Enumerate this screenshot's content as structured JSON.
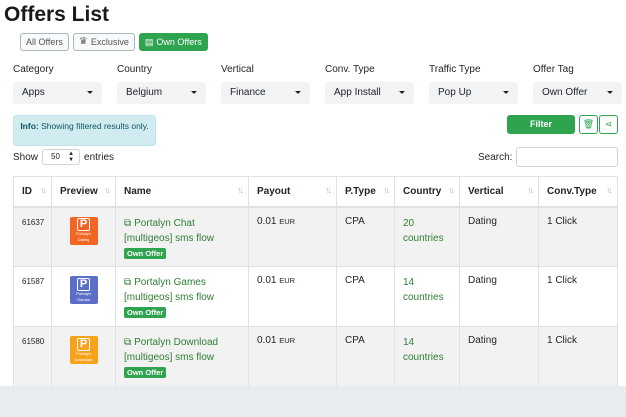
{
  "page": {
    "title": "Offers List"
  },
  "tabs": [
    {
      "label": "All Offers",
      "icon": ""
    },
    {
      "label": "Exclusive",
      "icon": "crown-icon"
    },
    {
      "label": "Own Offers",
      "icon": "document-icon"
    }
  ],
  "filters": [
    {
      "label": "Category",
      "value": "Apps"
    },
    {
      "label": "Country",
      "value": "Belgium"
    },
    {
      "label": "Vertical",
      "value": "Finance"
    },
    {
      "label": "Conv. Type",
      "value": "App Install"
    },
    {
      "label": "Traffic Type",
      "value": "Pop Up"
    },
    {
      "label": "Offer Tag",
      "value": "Own Offer"
    }
  ],
  "info": {
    "prefix": "Info:",
    "text": "Showing filtered results only."
  },
  "actions": {
    "filter_label": "Filter",
    "trash_icon": "trash-icon",
    "share_icon": "share-icon"
  },
  "length": {
    "show": "Show",
    "value": "50",
    "entries": "entries"
  },
  "search": {
    "label": "Search:"
  },
  "table": {
    "columns": [
      "ID",
      "Preview",
      "Name",
      "Payout",
      "P.Type",
      "Country",
      "Vertical",
      "Conv.Type"
    ],
    "rows": [
      {
        "id": "61637",
        "preview_text": "Portalyn",
        "preview_sub": "Dating",
        "preview_color": "#f26522",
        "name": "Portalyn Chat [multigeos] sms flow",
        "badge": "Own Offer",
        "payout": "0.01",
        "currency": "EUR",
        "ptype": "CPA",
        "country": "20 countries",
        "vertical": "Dating",
        "conv": "1 Click"
      },
      {
        "id": "61587",
        "preview_text": "Portalyn",
        "preview_sub": "Games",
        "preview_color": "#5b6fc7",
        "name": "Portalyn Games [multigeos] sms flow",
        "badge": "Own Offer",
        "payout": "0.01",
        "currency": "EUR",
        "ptype": "CPA",
        "country": "14 countries",
        "vertical": "Dating",
        "conv": "1 Click"
      },
      {
        "id": "61580",
        "preview_text": "Portalyn",
        "preview_sub": "Download",
        "preview_color": "#f7a21b",
        "name": "Portalyn Download [multigeos] sms flow",
        "badge": "Own Offer",
        "payout": "0.01",
        "currency": "EUR",
        "ptype": "CPA",
        "country": "14 countries",
        "vertical": "Dating",
        "conv": "1 Click"
      }
    ]
  },
  "colors": {
    "accent": "#2ea44f",
    "info_bg": "#d1ecf1",
    "link": "#2e7d32"
  }
}
